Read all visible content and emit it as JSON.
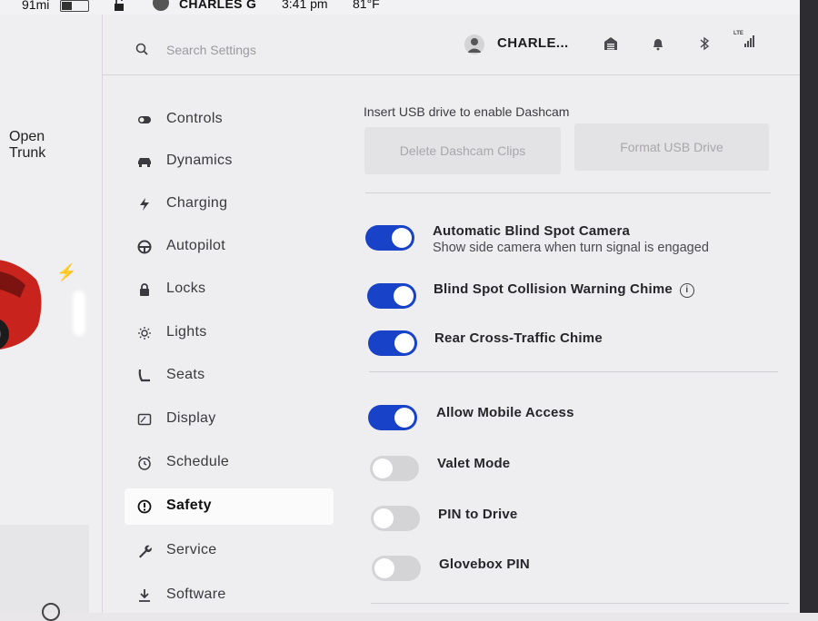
{
  "status_bar": {
    "range": "91mi",
    "user_name": "CHARLES G",
    "time": "3:41 pm",
    "temperature": "81°F"
  },
  "car_panel": {
    "open_trunk_line1": "Open",
    "open_trunk_line2": "Trunk",
    "car_color": "#c8231c"
  },
  "header": {
    "search_placeholder": "Search Settings",
    "profile_name": "CHARLE...",
    "icons": [
      "garage-icon",
      "bell-icon",
      "bluetooth-icon",
      "lte-signal-icon"
    ],
    "lte_label": "LTE"
  },
  "nav": {
    "items": [
      {
        "label": "Controls",
        "icon": "toggle-icon"
      },
      {
        "label": "Dynamics",
        "icon": "car-icon"
      },
      {
        "label": "Charging",
        "icon": "bolt-icon"
      },
      {
        "label": "Autopilot",
        "icon": "steering-wheel-icon"
      },
      {
        "label": "Locks",
        "icon": "lock-icon"
      },
      {
        "label": "Lights",
        "icon": "sun-icon"
      },
      {
        "label": "Seats",
        "icon": "seat-icon"
      },
      {
        "label": "Display",
        "icon": "display-icon"
      },
      {
        "label": "Schedule",
        "icon": "clock-icon"
      },
      {
        "label": "Safety",
        "icon": "alert-icon",
        "active": true
      },
      {
        "label": "Service",
        "icon": "wrench-icon"
      },
      {
        "label": "Software",
        "icon": "download-icon"
      }
    ]
  },
  "dashcam": {
    "note": "Insert USB drive to enable Dashcam",
    "delete_label": "Delete Dashcam Clips",
    "format_label": "Format USB Drive"
  },
  "safety_settings": [
    {
      "label": "Automatic Blind Spot Camera",
      "sublabel": "Show side camera when turn signal is engaged",
      "on": true
    },
    {
      "label": "Blind Spot Collision Warning Chime",
      "on": true,
      "info": true
    },
    {
      "label": "Rear Cross-Traffic Chime",
      "on": true
    }
  ],
  "access_settings": [
    {
      "label": "Allow Mobile Access",
      "on": true
    },
    {
      "label": "Valet Mode",
      "on": false
    },
    {
      "label": "PIN to Drive",
      "on": false
    },
    {
      "label": "Glovebox PIN",
      "on": false
    }
  ],
  "colors": {
    "toggle_on": "#1842c8",
    "toggle_off": "#d4d3d6",
    "background": "#eeedf0"
  }
}
